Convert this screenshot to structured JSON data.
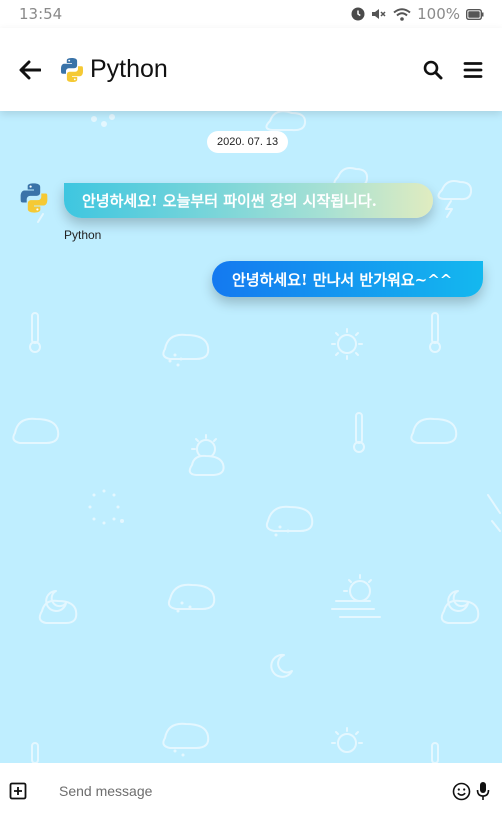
{
  "status_bar": {
    "time": "13:54",
    "battery": "100%"
  },
  "header": {
    "title": "Python",
    "icons": {
      "back": "arrow-left-icon",
      "search": "search-icon",
      "menu": "menu-icon",
      "logo": "python-logo-icon"
    }
  },
  "chat": {
    "date": "2020. 07. 13",
    "messages": [
      {
        "direction": "incoming",
        "sender": "Python",
        "text": "안녕하세요! 오늘부터 파이썬 강의 시작됩니다."
      },
      {
        "direction": "outgoing",
        "text": "안녕하세요! 만나서 반가워요~^^"
      }
    ]
  },
  "input": {
    "placeholder": "Send message",
    "icons": {
      "attach": "add-box-icon",
      "emoji": "smiley-icon",
      "voice": "microphone-icon"
    }
  },
  "colors": {
    "chat_background": "#bfeeff",
    "incoming_gradient": [
      "#3ec6e0",
      "#e0ecc0"
    ],
    "outgoing_gradient": [
      "#1479f0",
      "#14b8ef"
    ]
  }
}
